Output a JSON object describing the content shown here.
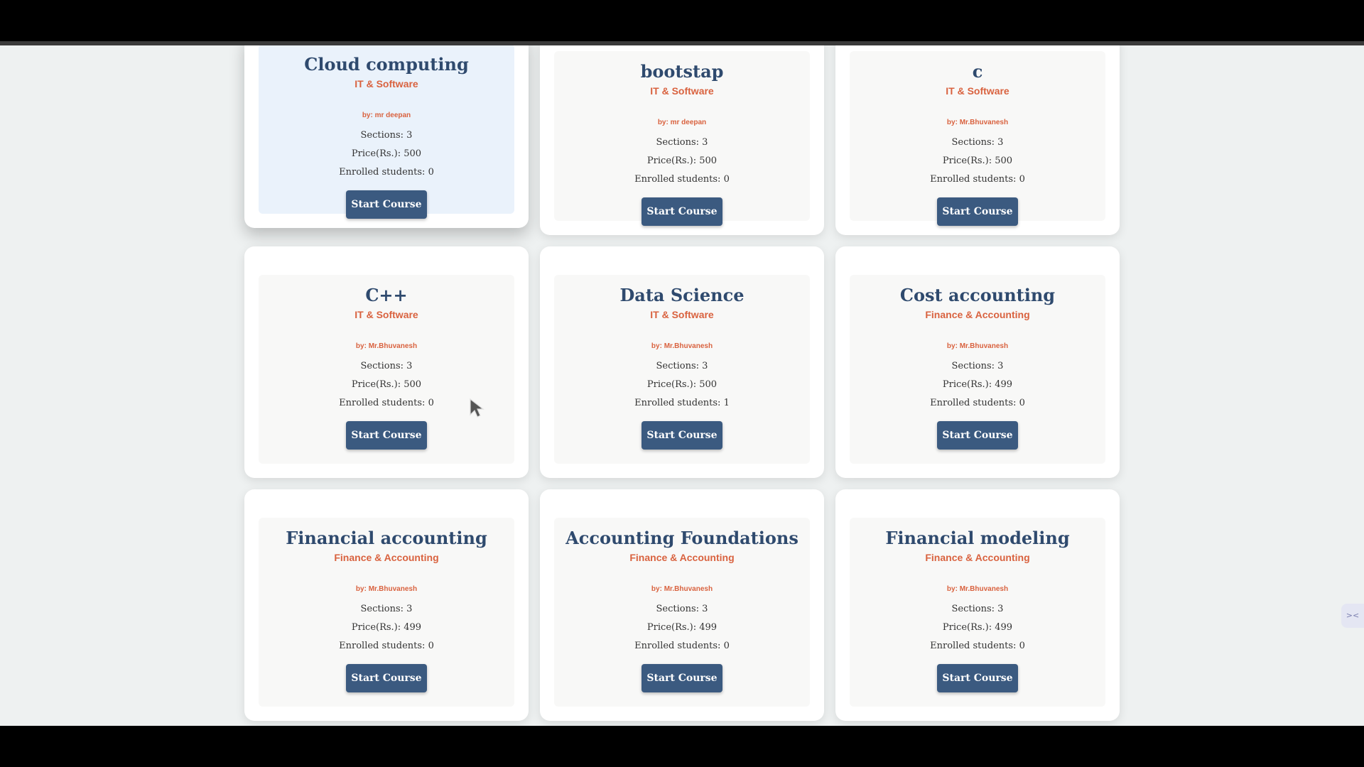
{
  "button_label": "Start Course",
  "courses": [
    {
      "title": "Cloud computing",
      "category": "IT & Software",
      "author": "by:  mr deepan",
      "sections": "Sections: 3",
      "price": "Price(Rs.): 500",
      "enrolled": "Enrolled students: 0"
    },
    {
      "title": "bootstap",
      "category": "IT & Software",
      "author": "by:  mr deepan",
      "sections": "Sections: 3",
      "price": "Price(Rs.): 500",
      "enrolled": "Enrolled students: 0"
    },
    {
      "title": "c",
      "category": "IT & Software",
      "author": "by:  Mr.Bhuvanesh",
      "sections": "Sections: 3",
      "price": "Price(Rs.): 500",
      "enrolled": "Enrolled students: 0"
    },
    {
      "title": "C++",
      "category": "IT & Software",
      "author": "by:  Mr.Bhuvanesh",
      "sections": "Sections: 3",
      "price": "Price(Rs.): 500",
      "enrolled": "Enrolled students: 0"
    },
    {
      "title": "Data Science",
      "category": "IT & Software",
      "author": "by:  Mr.Bhuvanesh",
      "sections": "Sections: 3",
      "price": "Price(Rs.): 500",
      "enrolled": "Enrolled students: 1"
    },
    {
      "title": "Cost accounting",
      "category": "Finance & Accounting",
      "author": "by:  Mr.Bhuvanesh",
      "sections": "Sections: 3",
      "price": "Price(Rs.): 499",
      "enrolled": "Enrolled students: 0"
    },
    {
      "title": "Financial accounting",
      "category": "Finance & Accounting",
      "author": "by:  Mr.Bhuvanesh",
      "sections": "Sections: 3",
      "price": "Price(Rs.): 499",
      "enrolled": "Enrolled students: 0"
    },
    {
      "title": "Accounting Foundations",
      "category": "Finance & Accounting",
      "author": "by:  Mr.Bhuvanesh",
      "sections": "Sections: 3",
      "price": "Price(Rs.): 499",
      "enrolled": "Enrolled students: 0"
    },
    {
      "title": "Financial modeling",
      "category": "Finance & Accounting",
      "author": "by:  Mr.Bhuvanesh",
      "sections": "Sections: 3",
      "price": "Price(Rs.): 499",
      "enrolled": "Enrolled students: 0"
    }
  ],
  "colors": {
    "title": "#2f4a6e",
    "category": "#d9623f",
    "button": "#3b5a80",
    "page_background": "#eef1f1"
  },
  "side_widget_icon": "collapse-arrows-icon"
}
